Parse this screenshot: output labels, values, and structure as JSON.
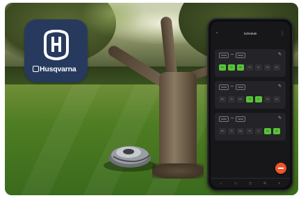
{
  "app_icon": {
    "brand_name": "Husqvarna",
    "icon": "husqvarna-logo-icon",
    "background_color": "#273a5e"
  },
  "phone": {
    "title": "Schedule",
    "back_icon": "back-arrow-icon",
    "menu_icon": "more-menu-icon",
    "schedules": [
      {
        "start": "00:00",
        "end": "00:00",
        "action_icon": "edit-icon",
        "days": [
          "Mo",
          "Tu",
          "We",
          "Th",
          "Fr",
          "Sa",
          "Su"
        ],
        "active": [
          true,
          true,
          true,
          false,
          false,
          false,
          false
        ]
      },
      {
        "start": "00:00",
        "end": "00:00",
        "action_icon": "edit-icon",
        "days": [
          "Mo",
          "Tu",
          "We",
          "Th",
          "Fr",
          "Sa",
          "Su"
        ],
        "active": [
          false,
          false,
          false,
          true,
          true,
          false,
          false
        ]
      },
      {
        "start": "00:00",
        "end": "00:00",
        "action_icon": "edit-icon",
        "days": [
          "Mo",
          "Tu",
          "We",
          "Th",
          "Fr",
          "Sa",
          "Su"
        ],
        "active": [
          false,
          false,
          false,
          false,
          false,
          true,
          true
        ]
      }
    ],
    "add_button_icon": "add-icon",
    "accent_color": "#59c23a",
    "fab_color": "#f0542a",
    "nav_items": [
      "home-icon",
      "map-icon",
      "schedule-icon",
      "settings-icon",
      "more-icon"
    ]
  }
}
